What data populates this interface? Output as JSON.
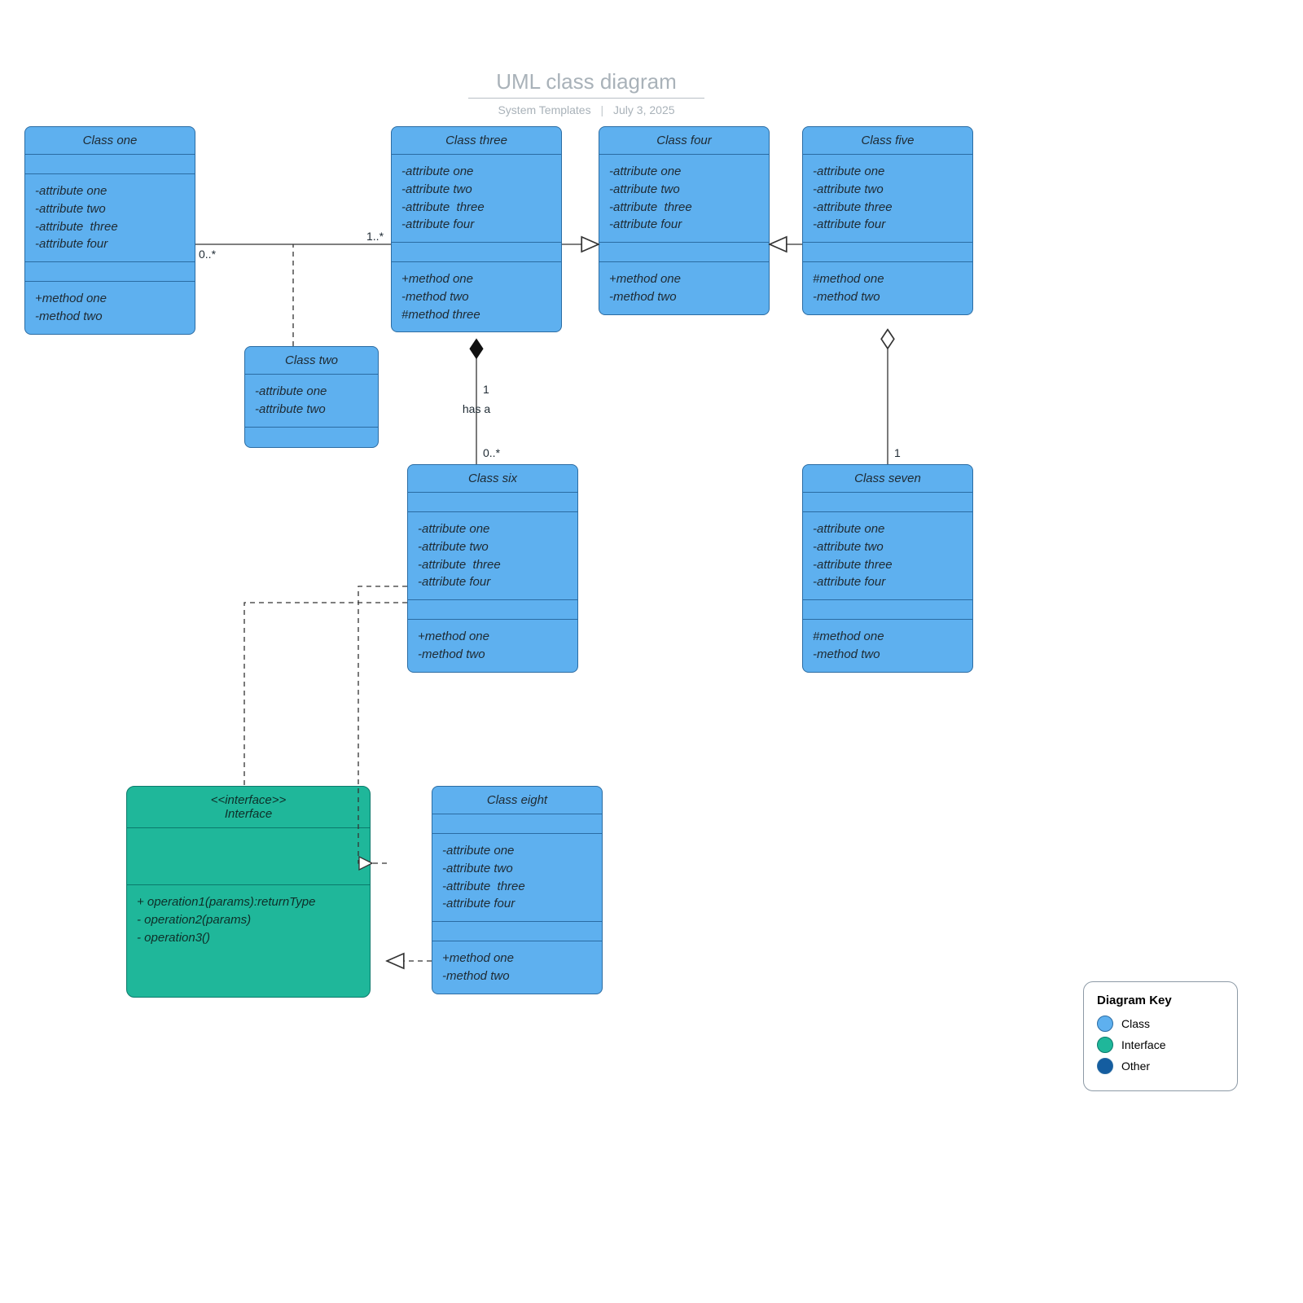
{
  "title": "UML class diagram",
  "subtitle_left": "System Templates",
  "subtitle_right": "July 3, 2025",
  "classes": {
    "c1": {
      "name": "Class one",
      "attrs": "-attribute one\n-attribute two\n-attribute  three\n-attribute four",
      "methods": "+method one\n-method two"
    },
    "c2": {
      "name": "Class two",
      "attrs": "-attribute one\n-attribute two",
      "methods": ""
    },
    "c3": {
      "name": "Class three",
      "attrs": "-attribute one\n-attribute two\n-attribute  three\n-attribute four",
      "methods": "+method one\n-method two\n#method three"
    },
    "c4": {
      "name": "Class four",
      "attrs": "-attribute one\n-attribute two\n-attribute  three\n-attribute four",
      "methods": "+method one\n-method two"
    },
    "c5": {
      "name": "Class five",
      "attrs": "-attribute one\n-attribute two\n-attribute three\n-attribute four",
      "methods": "#method one\n-method two"
    },
    "c6": {
      "name": "Class six",
      "attrs": "-attribute one\n-attribute two\n-attribute  three\n-attribute four",
      "methods": "+method one\n-method two"
    },
    "c7": {
      "name": "Class seven",
      "attrs": "-attribute one\n-attribute two\n-attribute three\n-attribute four",
      "methods": "#method one\n-method two"
    },
    "c8": {
      "name": "Class eight",
      "attrs": "-attribute one\n-attribute two\n-attribute  three\n-attribute four",
      "methods": "+method one\n-method two"
    },
    "iface": {
      "stereotype": "<<interface>>",
      "name": "Interface",
      "ops": "+ operation1(params):returnType\n- operation2(params)\n- operation3()"
    }
  },
  "edge_labels": {
    "assoc_left": "0..*",
    "assoc_right": "1..*",
    "comp_top": "1",
    "comp_rel": "has\na",
    "comp_bot": "0..*",
    "agg_bot": "1"
  },
  "legend": {
    "title": "Diagram Key",
    "items": [
      "Class",
      "Interface",
      "Other"
    ]
  },
  "colors": {
    "class_fill": "#5eb0ef",
    "class_stroke": "#2b6ca3",
    "interface_fill": "#1fb79a",
    "interface_stroke": "#0b7a6b",
    "other_fill": "#145da0"
  }
}
